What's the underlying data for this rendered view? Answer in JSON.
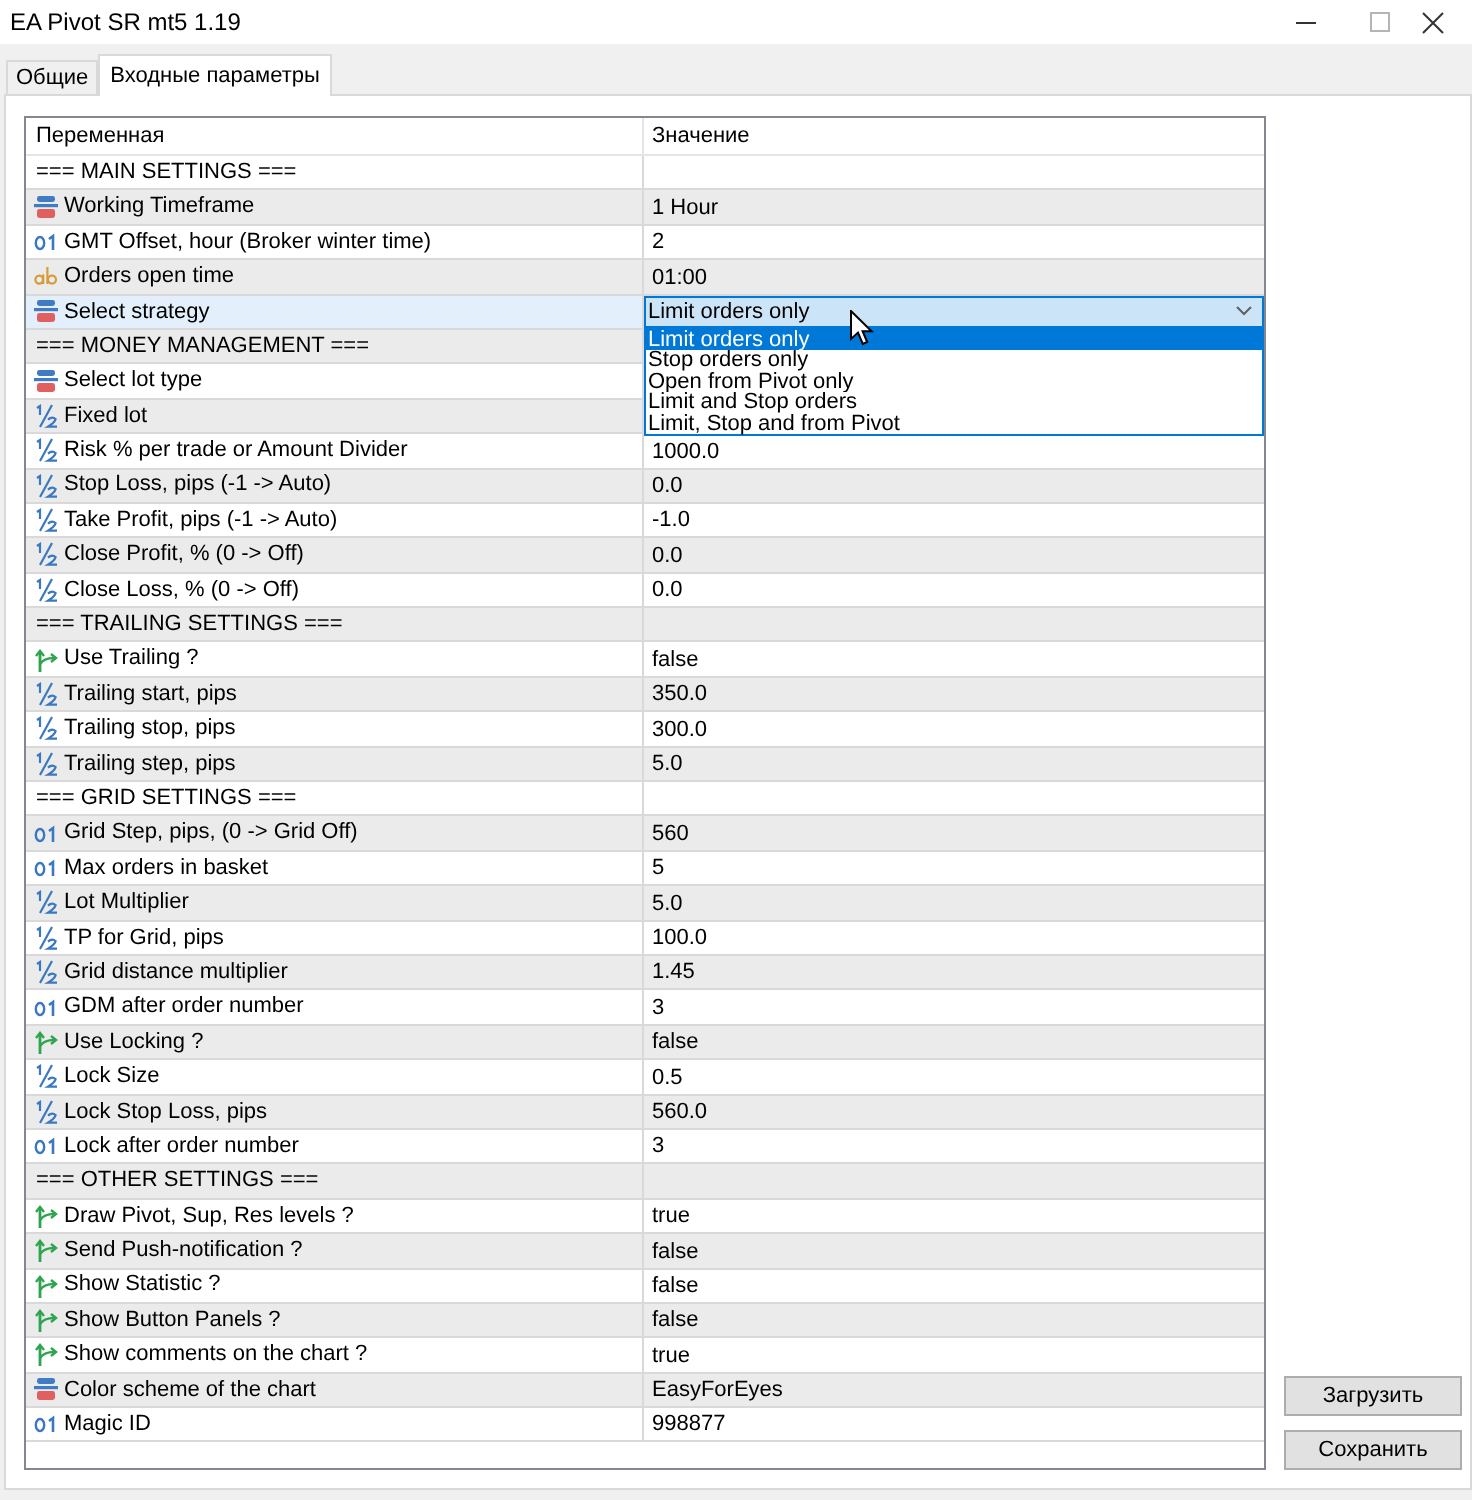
{
  "window": {
    "title": "EA Pivot SR mt5 1.19"
  },
  "tabs": [
    {
      "label": "Общие",
      "selected": false
    },
    {
      "label": "Входные параметры",
      "selected": true
    }
  ],
  "table": {
    "columns": [
      "Переменная",
      "Значение"
    ],
    "rows": [
      {
        "kind": "section",
        "name": "=== MAIN SETTINGS ===",
        "selected": false
      },
      {
        "kind": "enum",
        "name": "Working Timeframe",
        "value": "1 Hour",
        "selected": false
      },
      {
        "kind": "int",
        "name": "GMT Offset, hour (Broker winter time)",
        "value": "2",
        "selected": false
      },
      {
        "kind": "string",
        "name": "Orders open time",
        "value": "01:00",
        "selected": false
      },
      {
        "kind": "enum",
        "name": "Select strategy",
        "value": "Limit orders only",
        "selected": true,
        "dropdown": {
          "expanded": true,
          "options": [
            {
              "label": "Limit orders only",
              "selected": true
            },
            {
              "label": "Stop orders only",
              "selected": false
            },
            {
              "label": "Open from Pivot only",
              "selected": false
            },
            {
              "label": "Limit and Stop orders",
              "selected": false
            },
            {
              "label": "Limit, Stop and from Pivot",
              "selected": false
            }
          ]
        }
      },
      {
        "kind": "section",
        "name": "=== MONEY MANAGEMENT ===",
        "selected": false
      },
      {
        "kind": "enum",
        "name": "Select lot type",
        "selected": false
      },
      {
        "kind": "double",
        "name": "Fixed lot",
        "selected": false
      },
      {
        "kind": "double",
        "name": "Risk % per trade or Amount Divider",
        "value": "1000.0",
        "selected": false
      },
      {
        "kind": "double",
        "name": "Stop Loss, pips (-1 -> Auto)",
        "value": "0.0",
        "selected": false
      },
      {
        "kind": "double",
        "name": "Take Profit, pips (-1 -> Auto)",
        "value": "-1.0",
        "selected": false
      },
      {
        "kind": "double",
        "name": "Close Profit, % (0 -> Off)",
        "value": "0.0",
        "selected": false
      },
      {
        "kind": "double",
        "name": "Close Loss, % (0 -> Off)",
        "value": "0.0",
        "selected": false
      },
      {
        "kind": "section",
        "name": "=== TRAILING SETTINGS ===",
        "selected": false
      },
      {
        "kind": "bool",
        "name": "Use Trailing ?",
        "value": "false",
        "selected": false
      },
      {
        "kind": "double",
        "name": "Trailing start, pips",
        "value": "350.0",
        "selected": false
      },
      {
        "kind": "double",
        "name": "Trailing stop, pips",
        "value": "300.0",
        "selected": false
      },
      {
        "kind": "double",
        "name": "Trailing step, pips",
        "value": "5.0",
        "selected": false
      },
      {
        "kind": "section",
        "name": "=== GRID SETTINGS ===",
        "selected": false
      },
      {
        "kind": "int",
        "name": "Grid Step, pips, (0 -> Grid Off)",
        "value": "560",
        "selected": false
      },
      {
        "kind": "int",
        "name": "Max orders in basket",
        "value": "5",
        "selected": false
      },
      {
        "kind": "double",
        "name": "Lot Multiplier",
        "value": "5.0",
        "selected": false
      },
      {
        "kind": "double",
        "name": "TP for Grid, pips",
        "value": "100.0",
        "selected": false
      },
      {
        "kind": "double",
        "name": "Grid distance multiplier",
        "value": "1.45",
        "selected": false
      },
      {
        "kind": "int",
        "name": "GDM after order number",
        "value": "3",
        "selected": false
      },
      {
        "kind": "bool",
        "name": "Use Locking ?",
        "value": "false",
        "selected": false
      },
      {
        "kind": "double",
        "name": "Lock Size",
        "value": "0.5",
        "selected": false
      },
      {
        "kind": "double",
        "name": "Lock Stop Loss, pips",
        "value": "560.0",
        "selected": false
      },
      {
        "kind": "int",
        "name": "Lock after order number",
        "value": "3",
        "selected": false
      },
      {
        "kind": "section",
        "name": "=== OTHER SETTINGS ===",
        "selected": false
      },
      {
        "kind": "bool",
        "name": "Draw Pivot, Sup, Res levels ?",
        "value": "true",
        "selected": false
      },
      {
        "kind": "bool",
        "name": "Send Push-notification ?",
        "value": "false",
        "selected": false
      },
      {
        "kind": "bool",
        "name": "Show Statistic ?",
        "value": "false",
        "selected": false
      },
      {
        "kind": "bool",
        "name": "Show Button Panels ?",
        "value": "false",
        "selected": false
      },
      {
        "kind": "bool",
        "name": "Show comments on the chart ?",
        "value": "true",
        "selected": false
      },
      {
        "kind": "enum",
        "name": "Color scheme of the chart",
        "value": "EasyForEyes",
        "selected": false
      },
      {
        "kind": "int",
        "name": "Magic ID",
        "value": "998877",
        "selected": false
      }
    ]
  },
  "buttons": [
    "Загрузить",
    "Сохранить"
  ]
}
